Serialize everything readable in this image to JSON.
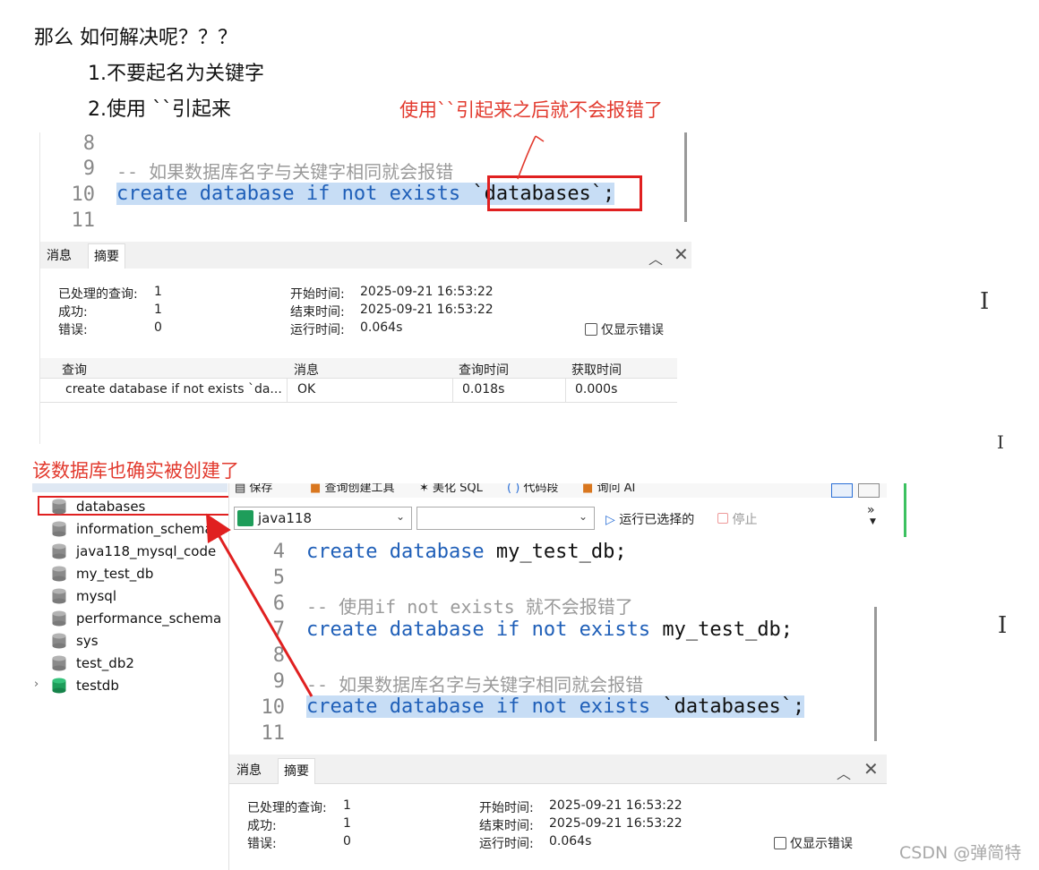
{
  "intro": {
    "question": "那么 如何解决呢？？？",
    "option1": "1.不要起名为关键字",
    "option2": "2.使用 ``引起来",
    "note_backtick": "使用``引起来之后就不会报错了",
    "note_created": "该数据库也确实被创建了"
  },
  "editor_top": {
    "lines": [
      {
        "num": "8",
        "text": ""
      },
      {
        "num": "9",
        "text": "-- 如果数据库名字与关键字相同就会报错"
      },
      {
        "num": "10",
        "kw": "create database if not exists",
        "rest": " `databases`;"
      },
      {
        "num": "11",
        "text": ""
      }
    ]
  },
  "result_panel_top": {
    "tabs": [
      "消息",
      "摘要"
    ],
    "processed_label": "已处理的查询:",
    "processed_value": "1",
    "success_label": "成功:",
    "success_value": "1",
    "error_label": "错误:",
    "error_value": "0",
    "start_label": "开始时间:",
    "start_value": "2025-09-21 16:53:22",
    "end_label": "结束时间:",
    "end_value": "2025-09-21 16:53:22",
    "runtime_label": "运行时间:",
    "runtime_value": "0.064s",
    "only_errors": "仅显示错误",
    "table": {
      "headers": [
        "查询",
        "消息",
        "查询时间",
        "获取时间"
      ],
      "row": [
        "create database if not exists `da...",
        "OK",
        "0.018s",
        "0.000s"
      ]
    }
  },
  "toolbar": {
    "save": "保存",
    "query_builder": "查询创建工具",
    "beautify": "美化 SQL",
    "snippet": "代码段",
    "ask_ai": "询问 AI",
    "connection": "java118",
    "database": "",
    "run_selected": "运行已选择的",
    "stop": "停止"
  },
  "tree": {
    "items": [
      "databases",
      "information_schema",
      "java118_mysql_code",
      "my_test_db",
      "mysql",
      "performance_schema",
      "sys",
      "test_db2",
      "testdb"
    ]
  },
  "editor_bottom": {
    "lines": [
      {
        "num": "4",
        "kw": "create database",
        "rest": " my_test_db;"
      },
      {
        "num": "5",
        "text": ""
      },
      {
        "num": "6",
        "text": "-- 使用if not exists 就不会报错了"
      },
      {
        "num": "7",
        "kw": "create database if not exists",
        "rest": " my_test_db;"
      },
      {
        "num": "8",
        "text": ""
      },
      {
        "num": "9",
        "text": "-- 如果数据库名字与关键字相同就会报错"
      },
      {
        "num": "10",
        "kw": "create database if not exists",
        "rest": " `databases`;"
      },
      {
        "num": "11",
        "text": ""
      }
    ]
  },
  "result_panel_bottom": {
    "tabs": [
      "消息",
      "摘要"
    ],
    "processed_label": "已处理的查询:",
    "processed_value": "1",
    "success_label": "成功:",
    "success_value": "1",
    "error_label": "错误:",
    "error_value": "0",
    "start_label": "开始时间:",
    "start_value": "2025-09-21 16:53:22",
    "end_label": "结束时间:",
    "end_value": "2025-09-21 16:53:22",
    "runtime_label": "运行时间:",
    "runtime_value": "0.064s",
    "only_errors": "仅显示错误"
  },
  "watermark": "CSDN @弹简特",
  "colors": {
    "annotation_red": "#e23a2e",
    "keyword_blue": "#1f5fb8",
    "selection": "#c7ddf5"
  }
}
